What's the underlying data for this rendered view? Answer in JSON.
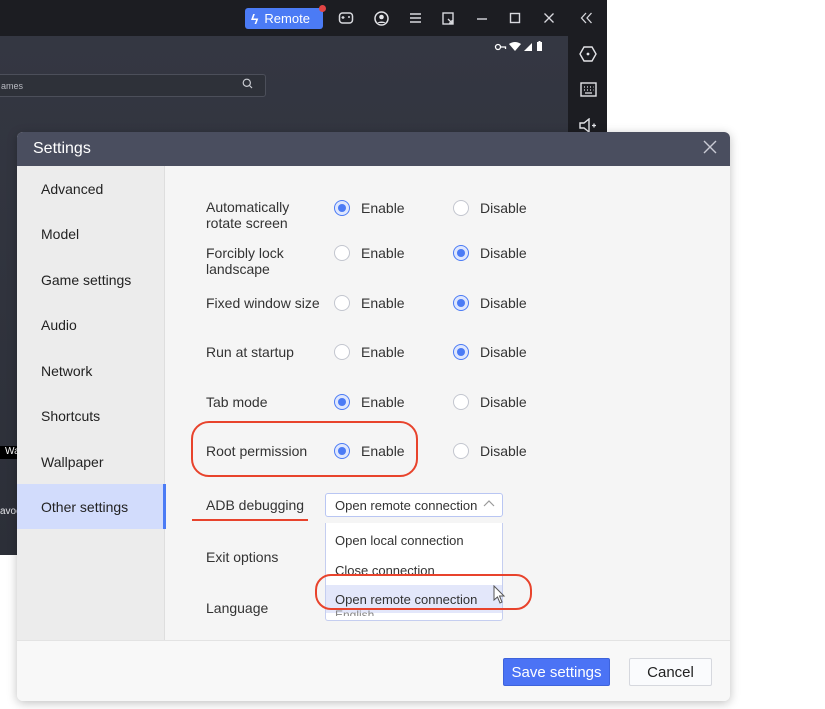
{
  "emulator": {
    "titlebar": {
      "remote_button": {
        "label": "Remote",
        "icon": "bolt-icon",
        "badge": "notification-dot",
        "color": "#4b7bf5"
      },
      "icons": [
        "gamepad-icon",
        "account-icon",
        "menu-icon",
        "screenshot-icon",
        "minimize-icon",
        "maximize-icon",
        "close-icon",
        "collapse-icon"
      ]
    },
    "status_bar": {
      "icons": [
        "vpn-key-icon",
        "wifi-icon",
        "signal-icon",
        "battery-icon"
      ]
    },
    "search": {
      "placeholder_fragment": "ames",
      "icon": "search-icon"
    },
    "sidebar_icons": [
      "hexagon-home-icon",
      "keyboard-icon",
      "volume-up-icon"
    ],
    "partial_text": {
      "wa": "Wa",
      "favo": "avoc"
    }
  },
  "dialog": {
    "title": "Settings",
    "close_icon": "close-icon",
    "nav": {
      "items": [
        {
          "label": "Advanced",
          "active": false
        },
        {
          "label": "Model",
          "active": false
        },
        {
          "label": "Game settings",
          "active": false
        },
        {
          "label": "Audio",
          "active": false
        },
        {
          "label": "Network",
          "active": false
        },
        {
          "label": "Shortcuts",
          "active": false
        },
        {
          "label": "Wallpaper",
          "active": false
        },
        {
          "label": "Other settings",
          "active": true
        }
      ]
    },
    "settings": {
      "enable_label": "Enable",
      "disable_label": "Disable",
      "rows": [
        {
          "label": "Automatically rotate screen",
          "value": "Enable"
        },
        {
          "label": "Forcibly lock landscape",
          "value": "Disable"
        },
        {
          "label": "Fixed window size",
          "value": "Disable"
        },
        {
          "label": "Run at startup",
          "value": "Disable"
        },
        {
          "label": "Tab mode",
          "value": "Enable"
        },
        {
          "label": "Root permission",
          "value": "Enable"
        }
      ],
      "adb": {
        "label": "ADB debugging",
        "selected": "Open remote connection",
        "options": [
          "Open local connection",
          "Close connection",
          "Open remote connection"
        ],
        "hovered": "Open remote connection"
      },
      "exit_options": {
        "label": "Exit options"
      },
      "language": {
        "label": "Language",
        "value": "English"
      }
    },
    "footer": {
      "save_label": "Save settings",
      "cancel_label": "Cancel"
    }
  },
  "annotations": {
    "color": "#e8432c",
    "highlighted": [
      "Root permission: Enable",
      "ADB debugging",
      "Open remote connection"
    ]
  }
}
